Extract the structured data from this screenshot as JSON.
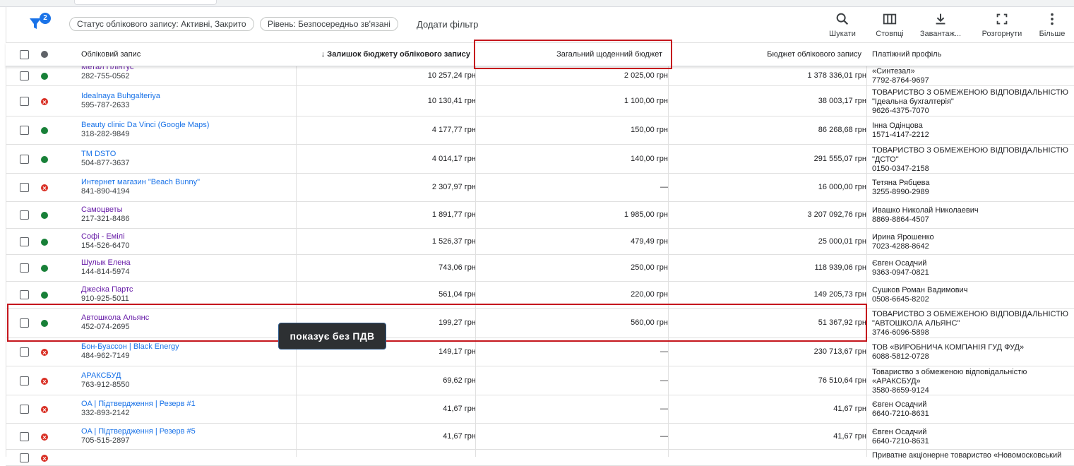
{
  "toolbar": {
    "filter_count": "2",
    "chips": [
      "Статус облікового запису: Активні, Закрито",
      "Рівень: Безпосередньо зв'язані"
    ],
    "add_filter": "Додати фільтр",
    "tools": [
      {
        "label": "Шукати",
        "icon": "search-icon"
      },
      {
        "label": "Стовпці",
        "icon": "columns-icon"
      },
      {
        "label": "Завантаж...",
        "icon": "download-icon"
      },
      {
        "label": "Розгорнути",
        "icon": "fullscreen-icon"
      },
      {
        "label": "Більше",
        "icon": "more-vert-icon"
      }
    ]
  },
  "columns": {
    "account": "Обліковий запис",
    "remaining": "Залишок бюджету облікового запису",
    "daily": "Загальний щоденний бюджет",
    "budget": "Бюджет облікового запису",
    "payment": "Платіжний профіль"
  },
  "rows": [
    {
      "status": "active",
      "name": "Метал Плінтус",
      "visited": true,
      "id": "282-755-0562",
      "remaining": "10 257,24 грн",
      "daily": "2 025,00 грн",
      "budget": "1 378 336,01 грн",
      "payment": [
        "«Синтезал»",
        "7792-8764-9697"
      ]
    },
    {
      "status": "closed",
      "name": "Idealnaya Buhgalteriya",
      "visited": false,
      "id": "595-787-2633",
      "remaining": "10 130,41 грн",
      "daily": "1 100,00 грн",
      "budget": "38 003,17 грн",
      "payment": [
        "ТОВАРИСТВО З ОБМЕЖЕНОЮ ВІДПОВІДАЛЬНІСТЮ",
        "\"Ідеальна бухгалтерія\"",
        "9626-4375-7070"
      ]
    },
    {
      "status": "active",
      "name": "Beauty clinic Da Vinci (Google Maps)",
      "visited": false,
      "id": "318-282-9849",
      "remaining": "4 177,77 грн",
      "daily": "150,00 грн",
      "budget": "86 268,68 грн",
      "payment": [
        "Інна Одінцова",
        "1571-4147-2212"
      ]
    },
    {
      "status": "active",
      "name": "TM DSTO",
      "visited": false,
      "id": "504-877-3637",
      "remaining": "4 014,17 грн",
      "daily": "140,00 грн",
      "budget": "291 555,07 грн",
      "payment": [
        "ТОВАРИСТВО З ОБМЕЖЕНОЮ ВІДПОВІДАЛЬНІСТЮ",
        "\"ДСТО\"",
        "0150-0347-2158"
      ]
    },
    {
      "status": "closed",
      "name": "Интернет магазин \"Beach Bunny\"",
      "visited": false,
      "id": "841-890-4194",
      "remaining": "2 307,97 грн",
      "daily": "—",
      "budget": "16 000,00 грн",
      "payment": [
        "Тетяна Рябцева",
        "3255-8990-2989"
      ]
    },
    {
      "status": "active",
      "name": "Самоцветы",
      "visited": true,
      "id": "217-321-8486",
      "remaining": "1 891,77 грн",
      "daily": "1 985,00 грн",
      "budget": "3 207 092,76 грн",
      "payment": [
        "Ивашко Николай Николаевич",
        "8869-8864-4507"
      ]
    },
    {
      "status": "active",
      "name": "Софі - Емілі",
      "visited": true,
      "id": "154-526-6470",
      "remaining": "1 526,37 грн",
      "daily": "479,49 грн",
      "budget": "25 000,01 грн",
      "payment": [
        "Ирина Ярошенко",
        "7023-4288-8642"
      ]
    },
    {
      "status": "active",
      "name": "Шулык Елена",
      "visited": true,
      "id": "144-814-5974",
      "remaining": "743,06 грн",
      "daily": "250,00 грн",
      "budget": "118 939,06 грн",
      "payment": [
        "Євген Осадчий",
        "9363-0947-0821"
      ]
    },
    {
      "status": "active",
      "name": "Джесіка Партс",
      "visited": true,
      "id": "910-925-5011",
      "remaining": "561,04 грн",
      "daily": "220,00 грн",
      "budget": "149 205,73 грн",
      "payment": [
        "Сушков Роман Вадимович",
        "0508-6645-8202"
      ]
    },
    {
      "status": "active",
      "name": "Автошкола Альянс",
      "visited": true,
      "id": "452-074-2695",
      "remaining": "199,27 грн",
      "daily": "560,00 грн",
      "budget": "51 367,92 грн",
      "payment": [
        "ТОВАРИСТВО З ОБМЕЖЕНОЮ ВІДПОВІДАЛЬНІСТЮ",
        "\"АВТОШКОЛА АЛЬЯНС\"",
        "3746-6096-5898"
      ]
    },
    {
      "status": "closed",
      "name": "Бон-Буассон | Black Energy",
      "visited": false,
      "id": "484-962-7149",
      "remaining": "149,17 грн",
      "daily": "—",
      "budget": "230 713,67 грн",
      "payment": [
        "ТОВ «ВИРОБНИЧА КОМПАНІЯ ГУД ФУД»",
        "6088-5812-0728"
      ]
    },
    {
      "status": "closed",
      "name": "АРАКСБУД",
      "visited": false,
      "id": "763-912-8550",
      "remaining": "69,62 грн",
      "daily": "—",
      "budget": "76 510,64 грн",
      "payment": [
        "Товариство з обмеженою відповідальністю",
        "«АРАКСБУД»",
        "3580-8659-9124"
      ]
    },
    {
      "status": "closed",
      "name": "OA | Підтвердження | Резерв #1",
      "visited": false,
      "id": "332-893-2142",
      "remaining": "41,67 грн",
      "daily": "—",
      "budget": "41,67 грн",
      "payment": [
        "Євген Осадчий",
        "6640-7210-8631"
      ]
    },
    {
      "status": "closed",
      "name": "OA | Підтвердження | Резерв #5",
      "visited": false,
      "id": "705-515-2897",
      "remaining": "41,67 грн",
      "daily": "—",
      "budget": "41,67 грн",
      "payment": [
        "Євген Осадчий",
        "6640-7210-8631"
      ]
    },
    {
      "status": "closed",
      "name": "",
      "visited": false,
      "id": "",
      "remaining": "",
      "daily": "",
      "budget": "",
      "payment": [
        "Приватне акціонерне товариство «Новомосковський"
      ]
    }
  ],
  "annotation": {
    "tooltip": "показує без ПДВ"
  }
}
